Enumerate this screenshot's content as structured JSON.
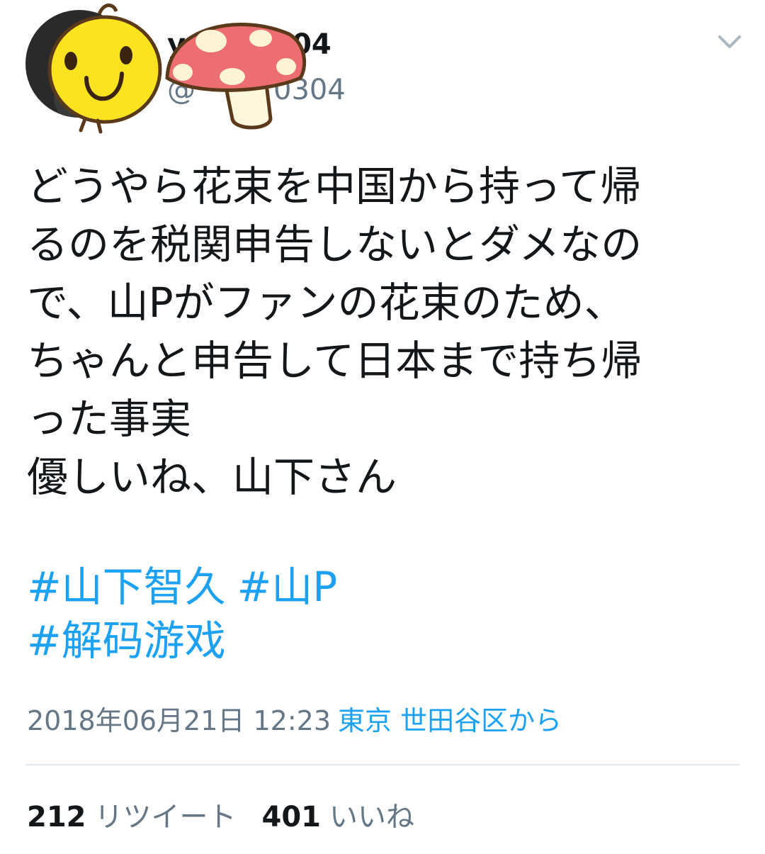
{
  "user": {
    "name_visible_prefix": "y",
    "name_visible_suffix": "04",
    "handle_prefix": "@",
    "handle_suffix": "0304"
  },
  "tweet": {
    "text": "どうやら花束を中国から持って帰\nるのを税関申告しないとダメなの\nで、山Pがファンの花束のため、\nちゃんと申告して日本まで持ち帰\nった事実\n優しいね、山下さん",
    "hashtags": [
      "#山下智久",
      "#山P",
      "#解码游戏"
    ],
    "timestamp": "2018年06月21日 12:23",
    "location": "東京 世田谷区から"
  },
  "stats": {
    "retweets_count": "212",
    "retweets_label": "リツイート",
    "likes_count": "401",
    "likes_label": "いいね"
  },
  "colors": {
    "accent": "#1da1f2",
    "secondary_text": "#657786",
    "primary_text": "#14171a",
    "divider": "#e1e8ed"
  },
  "icons": [
    "chevron-down-icon"
  ]
}
